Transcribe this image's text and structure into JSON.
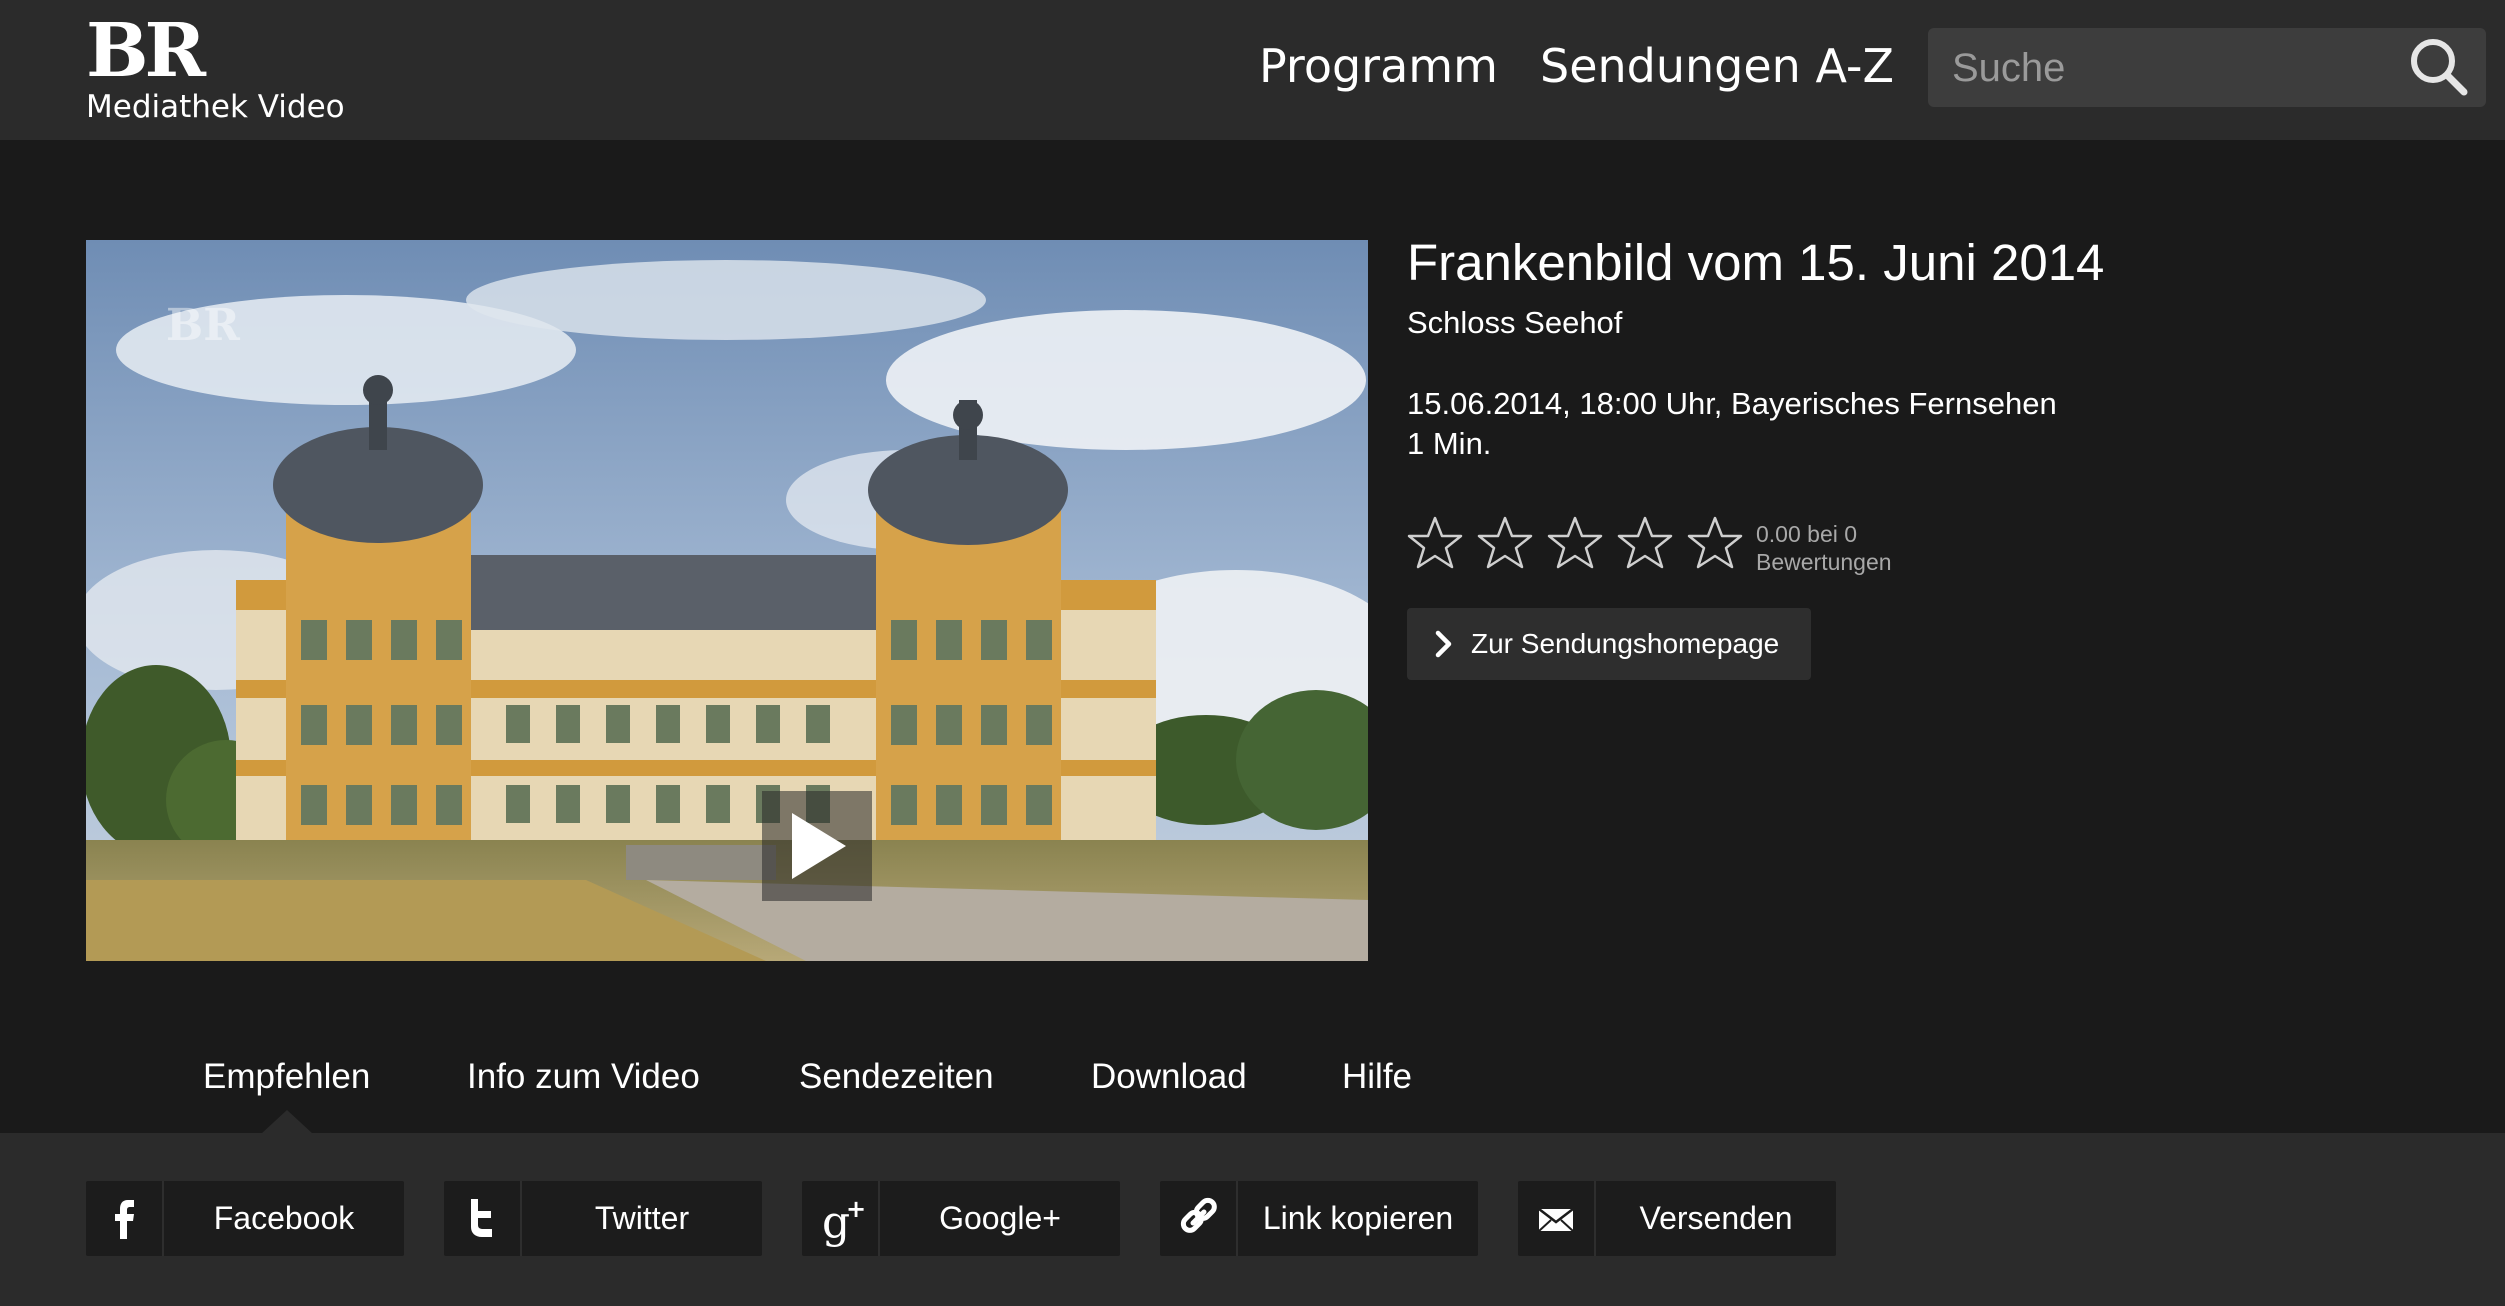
{
  "header": {
    "logo_mark": "BR",
    "logo_sub": "Mediathek Video",
    "nav": [
      {
        "label": "Programm"
      },
      {
        "label": "Sendungen A-Z"
      }
    ],
    "search": {
      "placeholder": "Suche",
      "value": ""
    }
  },
  "video": {
    "title": "Frankenbild vom 15. Juni 2014",
    "subtitle": "Schloss Seehof",
    "broadcast": "15.06.2014, 18:00 Uhr, Bayerisches Fernsehen",
    "duration": "1 Min.",
    "rating": {
      "value": 0,
      "max": 5,
      "label_line1": "0.00 bei 0",
      "label_line2": "Bewertungen"
    },
    "homepage_label": "Zur Sendungshomepage",
    "watermark": "BR"
  },
  "tabs": [
    {
      "label": "Empfehlen",
      "active": true
    },
    {
      "label": "Info zum Video",
      "active": false
    },
    {
      "label": "Sendezeiten",
      "active": false
    },
    {
      "label": "Download",
      "active": false
    },
    {
      "label": "Hilfe",
      "active": false
    }
  ],
  "share": [
    {
      "label": "Facebook",
      "icon": "facebook-icon"
    },
    {
      "label": "Twitter",
      "icon": "twitter-icon"
    },
    {
      "label": "Google+",
      "icon": "google-plus-icon"
    },
    {
      "label": "Link kopieren",
      "icon": "link-icon"
    },
    {
      "label": "Versenden",
      "icon": "mail-icon"
    }
  ],
  "colors": {
    "background": "#1a1a1a",
    "header": "#2b2b2b",
    "button": "#2e2e2e",
    "share_button": "#1c1c1c"
  }
}
